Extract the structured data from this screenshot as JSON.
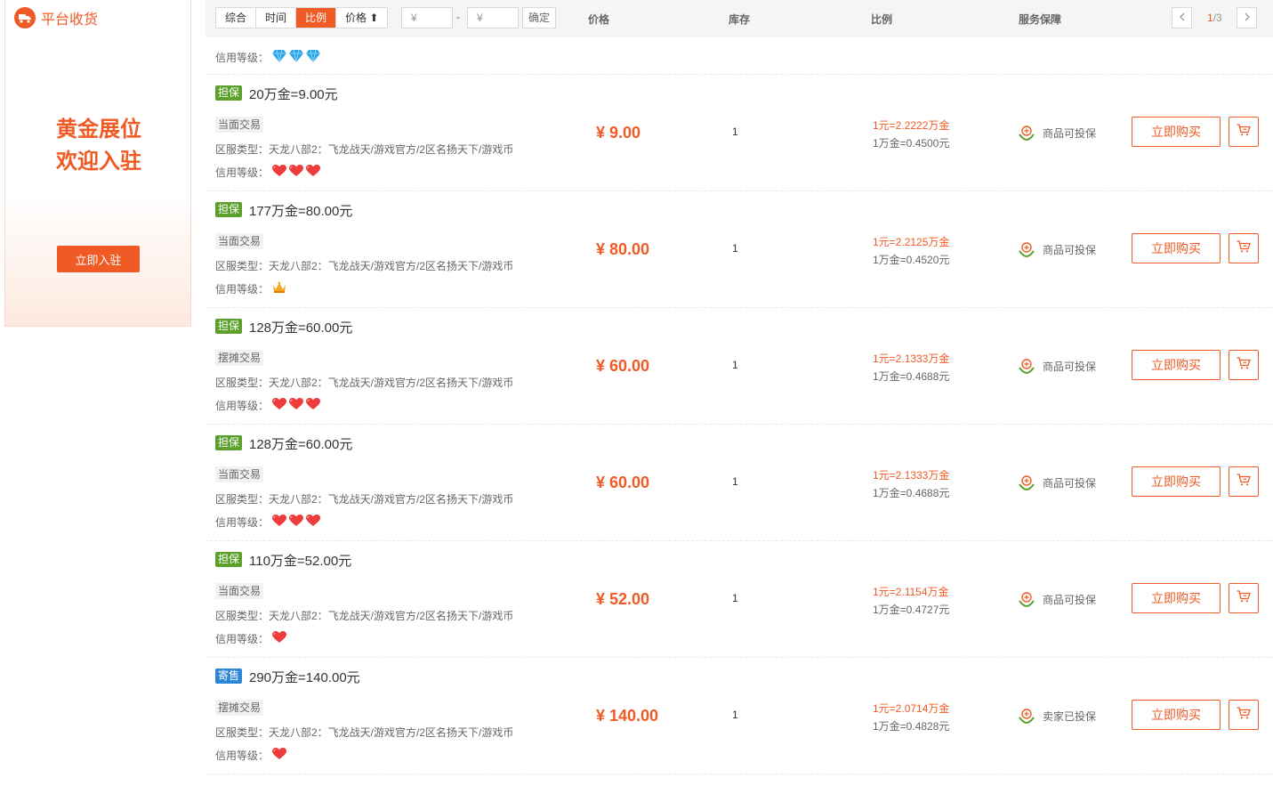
{
  "side": {
    "title": "平台收货",
    "gold_line1": "黄金展位",
    "gold_line2": "欢迎入驻",
    "join_label": "立即入驻"
  },
  "toolbar": {
    "sort_tabs": [
      "综合",
      "时间",
      "比例",
      "价格 ⬆"
    ],
    "active_tab": "比例",
    "min_placeholder": "¥",
    "max_placeholder": "¥",
    "dash": "-",
    "confirm": "确定",
    "col_price": "价格",
    "col_stock": "库存",
    "col_ratio": "比例",
    "col_service": "服务保障",
    "page_current": "1",
    "page_total": "/3"
  },
  "top_credit_label": "信用等级：",
  "colors": {
    "accent": "#f05a24",
    "tag_green": "#5ca02c",
    "tag_blue": "#2c86d8"
  },
  "rows": [
    {
      "tag": "担保",
      "tag_color": "green",
      "title": "20万金=9.00元",
      "trade_type": "当面交易",
      "zone": "区服类型：天龙八部2：飞龙战天/游戏官方/2区名扬天下/游戏币",
      "credit_label": "信用等级：",
      "credit_icon": "heart-icon",
      "credit_count": 3,
      "price": "¥ 9.00",
      "stock": "1",
      "ratio1": "1元=2.2222万金",
      "ratio2": "1万金=0.4500元",
      "service": "商品可投保",
      "buy": "立即购买"
    },
    {
      "tag": "担保",
      "tag_color": "green",
      "title": "177万金=80.00元",
      "trade_type": "当面交易",
      "zone": "区服类型：天龙八部2：飞龙战天/游戏官方/2区名扬天下/游戏币",
      "credit_label": "信用等级：",
      "credit_icon": "crown-icon",
      "credit_count": 1,
      "price": "¥ 80.00",
      "stock": "1",
      "ratio1": "1元=2.2125万金",
      "ratio2": "1万金=0.4520元",
      "service": "商品可投保",
      "buy": "立即购买"
    },
    {
      "tag": "担保",
      "tag_color": "green",
      "title": "128万金=60.00元",
      "trade_type": "摆摊交易",
      "zone": "区服类型：天龙八部2：飞龙战天/游戏官方/2区名扬天下/游戏币",
      "credit_label": "信用等级：",
      "credit_icon": "heart-icon",
      "credit_count": 3,
      "price": "¥ 60.00",
      "stock": "1",
      "ratio1": "1元=2.1333万金",
      "ratio2": "1万金=0.4688元",
      "service": "商品可投保",
      "buy": "立即购买"
    },
    {
      "tag": "担保",
      "tag_color": "green",
      "title": "128万金=60.00元",
      "trade_type": "当面交易",
      "zone": "区服类型：天龙八部2：飞龙战天/游戏官方/2区名扬天下/游戏币",
      "credit_label": "信用等级：",
      "credit_icon": "heart-icon",
      "credit_count": 3,
      "price": "¥ 60.00",
      "stock": "1",
      "ratio1": "1元=2.1333万金",
      "ratio2": "1万金=0.4688元",
      "service": "商品可投保",
      "buy": "立即购买"
    },
    {
      "tag": "担保",
      "tag_color": "green",
      "title": "110万金=52.00元",
      "trade_type": "当面交易",
      "zone": "区服类型：天龙八部2：飞龙战天/游戏官方/2区名扬天下/游戏币",
      "credit_label": "信用等级：",
      "credit_icon": "heart-icon",
      "credit_count": 1,
      "price": "¥ 52.00",
      "stock": "1",
      "ratio1": "1元=2.1154万金",
      "ratio2": "1万金=0.4727元",
      "service": "商品可投保",
      "buy": "立即购买"
    },
    {
      "tag": "寄售",
      "tag_color": "blue",
      "title": "290万金=140.00元",
      "trade_type": "摆摊交易",
      "zone": "区服类型：天龙八部2：飞龙战天/游戏官方/2区名扬天下/游戏币",
      "credit_label": "信用等级：",
      "credit_icon": "heart-icon",
      "credit_count": 1,
      "price": "¥ 140.00",
      "stock": "1",
      "ratio1": "1元=2.0714万金",
      "ratio2": "1万金=0.4828元",
      "service": "卖家已投保",
      "buy": "立即购买"
    }
  ]
}
